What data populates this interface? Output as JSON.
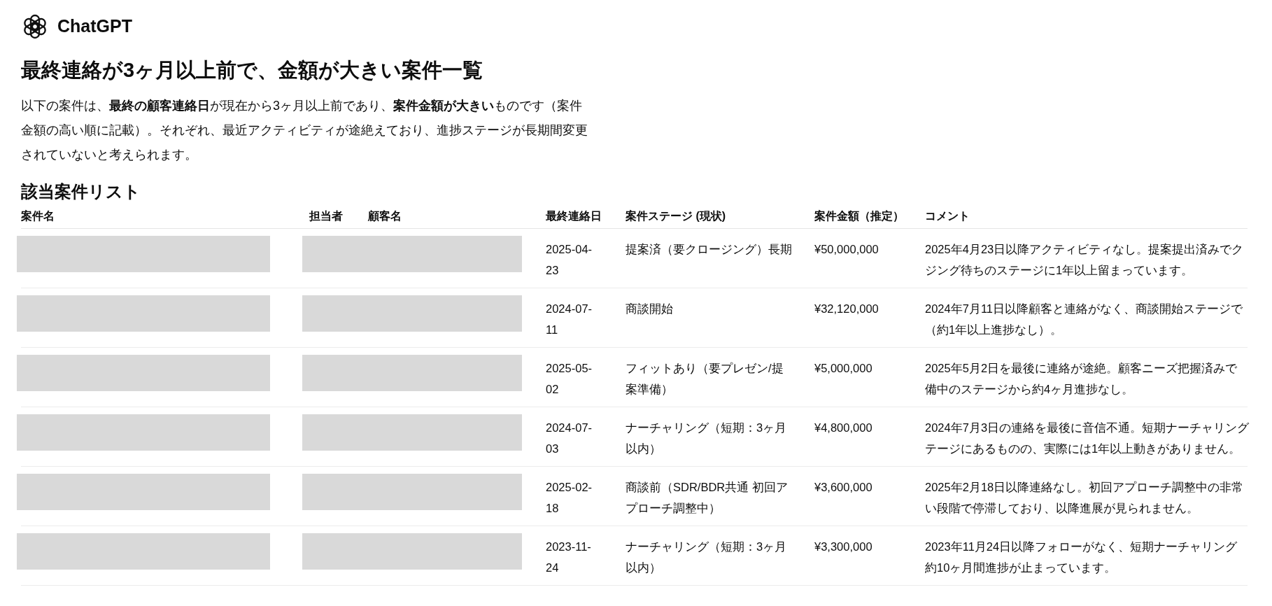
{
  "brand": {
    "name": "ChatGPT"
  },
  "title": "最終連絡が3ヶ月以上前で、金額が大きい案件一覧",
  "intro": "以下の案件は、**最終の顧客連絡日**が現在から3ヶ月以上前であり、**案件金額が大きい**ものです（案件金額の高い順に記載）。それぞれ、最近アクティビティが途絶えており、進捗ステージが長期間変更されていないと考えられます。",
  "section_title": "該当案件リスト",
  "table": {
    "columns": [
      "案件名",
      "担当者",
      "顧客名",
      "最終連絡日",
      "案件ステージ (現状)",
      "案件金額（推定）",
      "コメント"
    ],
    "rows": [
      {
        "project_redacted": true,
        "people_redacted": true,
        "last_contact": "2025-04-23",
        "stage": "提案済（要クロージング）長期",
        "amount": "¥50,000,000",
        "comment_lines": [
          "2025年4月23日以降アクティビティなし。提案提出済みでク",
          "ジング待ちのステージに1年以上留まっています。"
        ]
      },
      {
        "project_redacted": true,
        "people_redacted": true,
        "last_contact": "2024-07-11",
        "stage": "商談開始",
        "amount": "¥32,120,000",
        "comment_lines": [
          "2024年7月11日以降顧客と連絡がなく、商談開始ステージで",
          "（約1年以上進捗なし）。"
        ]
      },
      {
        "project_redacted": true,
        "people_redacted": true,
        "last_contact": "2025-05-02",
        "stage": "フィットあり（要プレゼン/提案準備）",
        "amount": "¥5,000,000",
        "comment_lines": [
          "2025年5月2日を最後に連絡が途絶。顧客ニーズ把握済みで",
          "備中のステージから約4ヶ月進捗なし。"
        ]
      },
      {
        "project_redacted": true,
        "people_redacted": true,
        "last_contact": "2024-07-03",
        "stage": "ナーチャリング（短期：3ヶ月以内）",
        "amount": "¥4,800,000",
        "comment_lines": [
          "2024年7月3日の連絡を最後に音信不通。短期ナーチャリング",
          "テージにあるものの、実際には1年以上動きがありません。"
        ]
      },
      {
        "project_redacted": true,
        "people_redacted": true,
        "last_contact": "2025-02-18",
        "stage": "商談前（SDR/BDR共通 初回アプローチ調整中）",
        "amount": "¥3,600,000",
        "comment_lines": [
          "2025年2月18日以降連絡なし。初回アプローチ調整中の非常",
          "い段階で停滞しており、以降進展が見られません。"
        ]
      },
      {
        "project_redacted": true,
        "people_redacted": true,
        "last_contact": "2023-11-24",
        "stage": "ナーチャリング（短期：3ヶ月以内）",
        "amount": "¥3,300,000",
        "comment_lines": [
          "2023年11月24日以降フォローがなく、短期ナーチャリング",
          "約10ヶ月間進捗が止まっています。"
        ]
      }
    ]
  }
}
